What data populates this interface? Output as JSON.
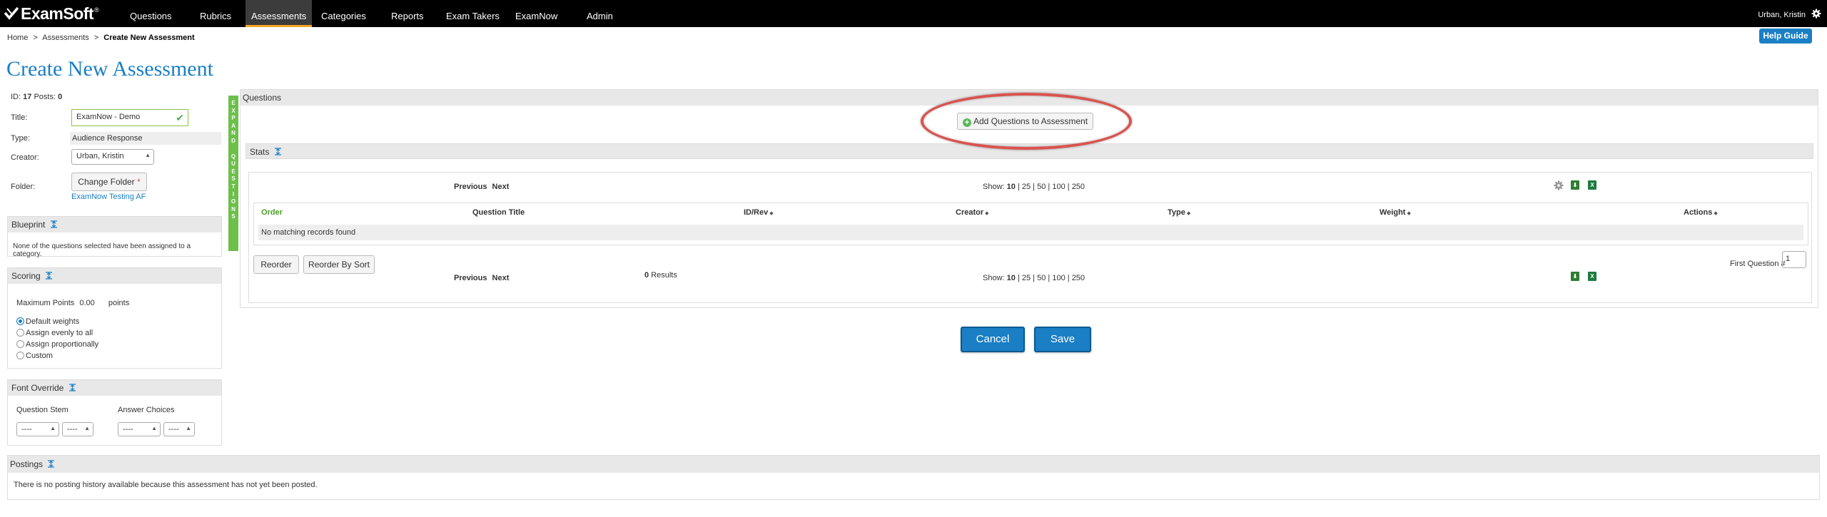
{
  "brand": {
    "logo_text": "ExamSoft",
    "reg_mark": "®"
  },
  "nav": {
    "items": [
      {
        "label": "Questions",
        "active": false
      },
      {
        "label": "Rubrics",
        "active": false
      },
      {
        "label": "Assessments",
        "active": true
      },
      {
        "label": "Categories",
        "active": false
      },
      {
        "label": "Reports",
        "active": false
      },
      {
        "label": "Exam Takers",
        "active": false
      },
      {
        "label": "ExamNow",
        "active": false
      },
      {
        "label": "Admin",
        "active": false
      }
    ],
    "user": "Urban, Kristin",
    "active_color": "#f5a623"
  },
  "breadcrumb": {
    "home": "Home",
    "sep": ">",
    "assessments": "Assessments",
    "current": "Create New Assessment"
  },
  "help_label": "Help Guide",
  "page_title": "Create New Assessment",
  "info": {
    "id_label": "ID:",
    "id_value": "17",
    "posts_label": "Posts:",
    "posts_value": "0",
    "title_label": "Title:",
    "title_value": "ExamNow - Demo",
    "type_label": "Type:",
    "type_value": "Audience Response",
    "creator_label": "Creator:",
    "creator_value": "Urban, Kristin",
    "folder_label": "Folder:",
    "change_folder": "Change Folder",
    "required_mark": "*",
    "folder_value": "ExamNow Testing AF"
  },
  "blueprint": {
    "title": "Blueprint",
    "text": "None of the questions selected have been assigned to a category."
  },
  "scoring": {
    "title": "Scoring",
    "max_label": "Maximum Points",
    "max_value": "0.00",
    "points_label": "points",
    "options": [
      {
        "label": "Default weights",
        "selected": true
      },
      {
        "label": "Assign evenly to all",
        "selected": false
      },
      {
        "label": "Assign proportionally",
        "selected": false
      },
      {
        "label": "Custom",
        "selected": false
      }
    ]
  },
  "font_override": {
    "title": "Font Override",
    "stem_label": "Question Stem",
    "answer_label": "Answer Choices",
    "placeholder": "----"
  },
  "expand_label": [
    "E",
    "X",
    "P",
    "A",
    "N",
    "D",
    "",
    "Q",
    "U",
    "E",
    "S",
    "T",
    "I",
    "O",
    "N",
    "S"
  ],
  "questions": {
    "header": "Questions",
    "add_button": "Add Questions to Assessment",
    "stats_label": "Stats",
    "pager": {
      "previous": "Previous",
      "next": "Next",
      "show_label": "Show:",
      "sizes": [
        "10",
        "25",
        "50",
        "100",
        "250"
      ],
      "current_size": "10"
    },
    "columns": [
      "Order",
      "Question Title",
      "ID/Rev",
      "Creator",
      "Type",
      "Weight",
      "Actions"
    ],
    "no_records": "No matching records found",
    "reorder": "Reorder",
    "reorder_sort": "Reorder By Sort",
    "first_question_label": "First Question #",
    "first_question_value": "1",
    "results_count": "0",
    "results_label": "Results"
  },
  "actions": {
    "cancel": "Cancel",
    "save": "Save"
  },
  "postings": {
    "title": "Postings",
    "text": "There is no posting history available because this assessment has not yet been posted."
  },
  "icons": {
    "settings": "gear-icon",
    "export_csv": "csv-export-icon",
    "export_excel": "excel-export-icon",
    "valid": "checkmark-icon",
    "toggle": "collapse-toggle-icon"
  },
  "colors": {
    "accent": "#1a7fc4",
    "expand_bar": "#6cc04a",
    "highlight_oval": "#d9534f"
  }
}
